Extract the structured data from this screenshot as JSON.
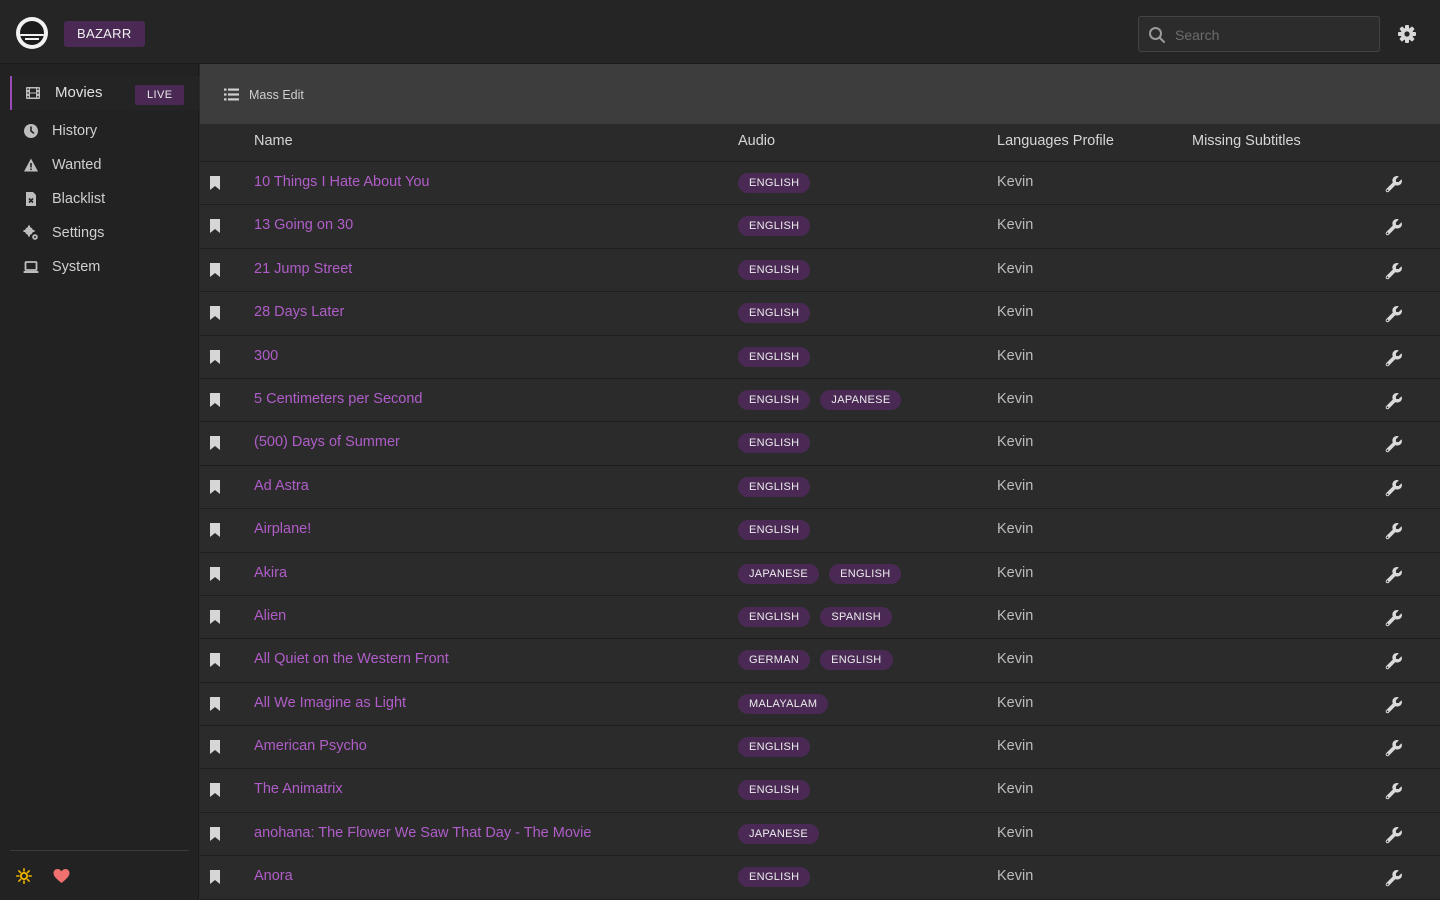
{
  "header": {
    "brand": "BAZARR",
    "search_placeholder": "Search"
  },
  "sidebar": {
    "items": [
      {
        "label": "Movies",
        "icon": "film-icon",
        "badge": "LIVE",
        "active": true
      },
      {
        "label": "History",
        "icon": "clock-icon"
      },
      {
        "label": "Wanted",
        "icon": "warning-icon"
      },
      {
        "label": "Blacklist",
        "icon": "file-x-icon"
      },
      {
        "label": "Settings",
        "icon": "cogs-icon"
      },
      {
        "label": "System",
        "icon": "laptop-icon"
      }
    ]
  },
  "toolbar": {
    "mass_edit_label": "Mass Edit"
  },
  "table": {
    "columns": [
      "Name",
      "Audio",
      "Languages Profile",
      "Missing Subtitles"
    ],
    "rows": [
      {
        "name": "10 Things I Hate About You",
        "audio": [
          "ENGLISH"
        ],
        "profile": "Kevin"
      },
      {
        "name": "13 Going on 30",
        "audio": [
          "ENGLISH"
        ],
        "profile": "Kevin"
      },
      {
        "name": "21 Jump Street",
        "audio": [
          "ENGLISH"
        ],
        "profile": "Kevin"
      },
      {
        "name": "28 Days Later",
        "audio": [
          "ENGLISH"
        ],
        "profile": "Kevin"
      },
      {
        "name": "300",
        "audio": [
          "ENGLISH"
        ],
        "profile": "Kevin"
      },
      {
        "name": "5 Centimeters per Second",
        "audio": [
          "ENGLISH",
          "JAPANESE"
        ],
        "profile": "Kevin"
      },
      {
        "name": "(500) Days of Summer",
        "audio": [
          "ENGLISH"
        ],
        "profile": "Kevin"
      },
      {
        "name": "Ad Astra",
        "audio": [
          "ENGLISH"
        ],
        "profile": "Kevin"
      },
      {
        "name": "Airplane!",
        "audio": [
          "ENGLISH"
        ],
        "profile": "Kevin"
      },
      {
        "name": "Akira",
        "audio": [
          "JAPANESE",
          "ENGLISH"
        ],
        "profile": "Kevin"
      },
      {
        "name": "Alien",
        "audio": [
          "ENGLISH",
          "SPANISH"
        ],
        "profile": "Kevin"
      },
      {
        "name": "All Quiet on the Western Front",
        "audio": [
          "GERMAN",
          "ENGLISH"
        ],
        "profile": "Kevin"
      },
      {
        "name": "All We Imagine as Light",
        "audio": [
          "MALAYALAM"
        ],
        "profile": "Kevin"
      },
      {
        "name": "American Psycho",
        "audio": [
          "ENGLISH"
        ],
        "profile": "Kevin"
      },
      {
        "name": "The Animatrix",
        "audio": [
          "ENGLISH"
        ],
        "profile": "Kevin"
      },
      {
        "name": "anohana: The Flower We Saw That Day - The Movie",
        "audio": [
          "JAPANESE"
        ],
        "profile": "Kevin"
      },
      {
        "name": "Anora",
        "audio": [
          "ENGLISH"
        ],
        "profile": "Kevin"
      }
    ]
  },
  "colors": {
    "accent": "#b05dc9",
    "badge_bg": "#4a2a55",
    "theme_icon": "#f0b400",
    "heart_icon": "#f07070"
  }
}
